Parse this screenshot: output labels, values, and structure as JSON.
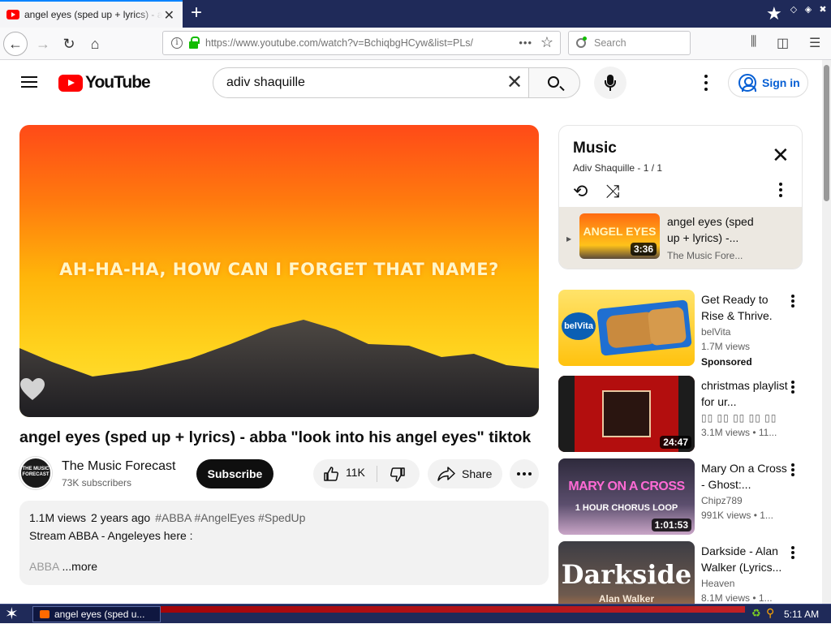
{
  "browser": {
    "tab_title": "angel eyes (sped up + lyrics) - abba \"look into his angel eyes\" tiktok",
    "tab_close": "✕",
    "new_tab": "+",
    "url": "https://www.youtube.com/watch?v=BchiqbgHCyw&list=PLs/",
    "url_dots": "•••",
    "search_placeholder": "Search",
    "window_controls": [
      "◇",
      "◈",
      "✖"
    ]
  },
  "youtube": {
    "logo_text": "YouTube",
    "search_query": "adiv shaquille",
    "sign_in": "Sign in"
  },
  "video": {
    "lyric_overlay": "AH-HA-HA, HOW CAN I FORGET THAT NAME?",
    "title": "angel eyes (sped up + lyrics) - abba \"look into his angel eyes\" tiktok",
    "channel_name": "The Music Forecast",
    "channel_avatar_text": "THE MUSIC FORECAST",
    "subscribers": "73K subscribers",
    "subscribe_label": "Subscribe",
    "likes": "11K",
    "share_label": "Share"
  },
  "description": {
    "views": "1.1M views",
    "age": "2 years ago",
    "tags": "#ABBA #AngelEyes #SpedUp",
    "line1": "Stream ABBA - Angeleyes here :",
    "line3_start": "ABBA",
    "more": "...more"
  },
  "playlist": {
    "title": "Music",
    "subtitle": "Adiv Shaquille - 1 / 1",
    "item": {
      "title": "angel eyes (sped up + lyrics) - abba \"look into his angel eyes\" tiktok",
      "channel": "The Music Fore...",
      "duration": "3:36",
      "thumb_text": "ANGEL EYES"
    }
  },
  "recommendations": [
    {
      "title": "Get Ready to Rise & Thrive.",
      "channel": "belVita",
      "views": "1.7M views",
      "badge": "Sponsored",
      "thumb_text": "belVita"
    },
    {
      "title": "christmas playlist for ur...",
      "channel": "",
      "views": "3.1M views • 11...",
      "duration": "24:47"
    },
    {
      "title": "Mary On a Cross - Ghost:...",
      "channel": "Chipz789",
      "views": "991K views • 1...",
      "duration": "1:01:53",
      "thumb_text": "MARY ON A CROSS",
      "thumb_sub": "1 HOUR CHORUS LOOP"
    },
    {
      "title": "Darkside - Alan Walker (Lyrics...",
      "channel": "Heaven",
      "views": "8.1M views • 1...",
      "thumb_text": "Darkside",
      "thumb_sub": "Alan Walker"
    }
  ],
  "taskbar": {
    "task_label": "angel eyes (sped u...",
    "clock": "5:11 AM"
  }
}
